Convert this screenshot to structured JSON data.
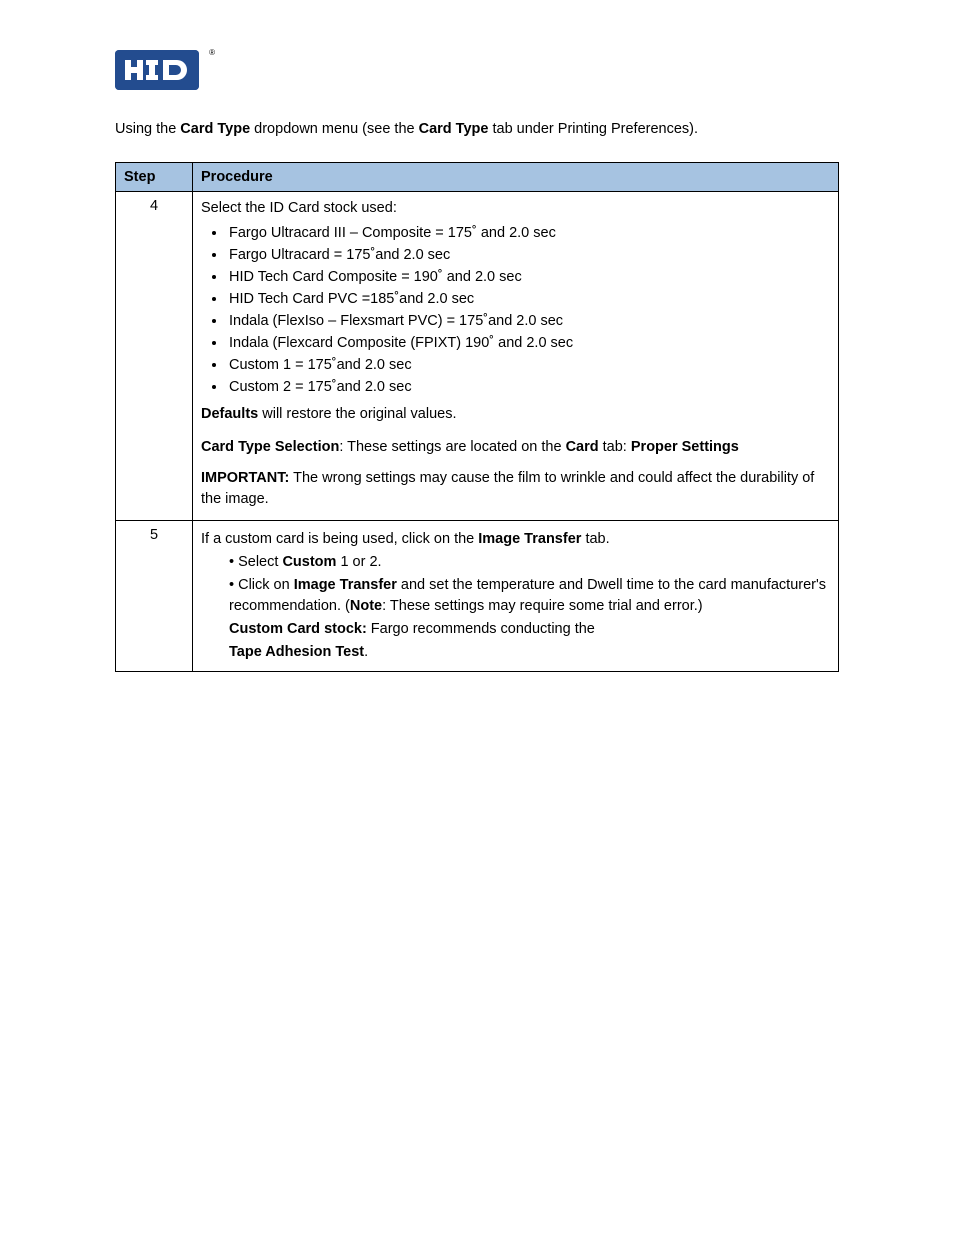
{
  "logo": {
    "alt": "HID",
    "reg": "®"
  },
  "intro": {
    "t1": "Using the ",
    "b1": "Card Type",
    "t2": " dropdown menu (see the ",
    "b2": "Card Type",
    "t3": " tab under Printing Preferences).",
    "row1_step": "4"
  },
  "headers": {
    "step": "Step",
    "procedure": "Procedure"
  },
  "row1": {
    "lead": "Select the ID Card stock used:",
    "items": [
      "Fargo Ultracard III – Composite = 175˚ and 2.0 sec",
      "Fargo Ultracard = 175˚and 2.0 sec",
      "HID Tech Card Composite = 190˚ and 2.0 sec",
      "HID Tech Card PVC =185˚and 2.0 sec",
      "Indala (FlexIso – Flexsmart PVC) = 175˚and 2.0 sec",
      "Indala (Flexcard Composite (FPIXT) 190˚ and 2.0 sec",
      "Custom 1 = 175˚and 2.0 sec",
      "Custom 2 = 175˚and 2.0 sec"
    ],
    "defaults_b": "Defaults",
    "defaults_t": " will restore the original values.",
    "cts_t1": "Card Type Selection",
    "cts_t2": ": These settings are located on the ",
    "cts_b1": "Card",
    "cts_t3": " tab: ",
    "cts_b2": "Proper Settings",
    "imp_b": "IMPORTANT:",
    "imp_t": " The wrong settings may cause the film to wrinkle and could affect the durability of the image."
  },
  "row2": {
    "step": "5",
    "l1a": "If a custom card is being used, click on the ",
    "l1b": "Image Transfer",
    "l1c": " tab.",
    "l2a": "• Select ",
    "l2b": "Custom",
    "l2c": " 1 or 2.",
    "l3a": "• Click on ",
    "l3b": "Image Transfer",
    "l3c": " and set the temperature and Dwell time to the card manufacturer's recommendation. (",
    "l3d": "Note",
    "l3e": ": These settings may require some trial and error.)",
    "l4b": "Custom Card stock:",
    "l4t": " Fargo recommends conducting the ",
    "l5b": "Tape Adhesion Test",
    "l5t": "."
  }
}
